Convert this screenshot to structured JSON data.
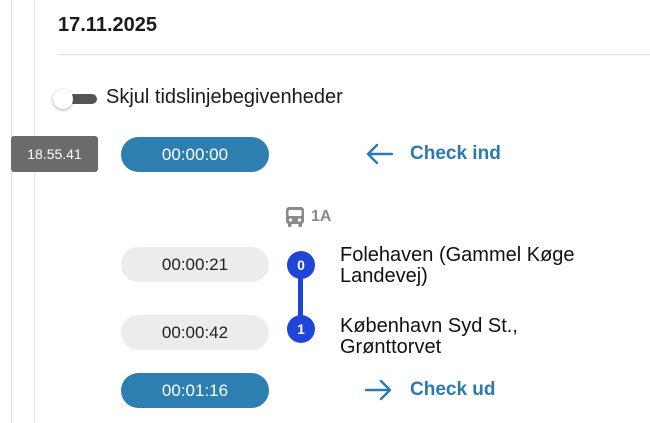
{
  "date": "17.11.2025",
  "toggle": {
    "label": "Skjul tidslinjebegivenheder",
    "checked": false
  },
  "clock_badge": "18.55.41",
  "check_in": {
    "time": "00:00:00",
    "label": "Check ind",
    "icon": "arrow-left-icon"
  },
  "route": {
    "icon": "bus-icon",
    "line": "1A"
  },
  "stops": [
    {
      "time": "00:00:21",
      "index": "0",
      "name": "Folehaven (Gammel Køge\nLandevej)"
    },
    {
      "time": "00:00:42",
      "index": "1",
      "name": "København Syd St.,\nGrønttorvet"
    }
  ],
  "check_out": {
    "time": "00:01:16",
    "label": "Check ud",
    "icon": "arrow-right-icon"
  },
  "colors": {
    "accent": "#2c7fb0",
    "route": "#1f45d8",
    "link": "#2a7ab0",
    "badge": "#6b6b6b"
  }
}
